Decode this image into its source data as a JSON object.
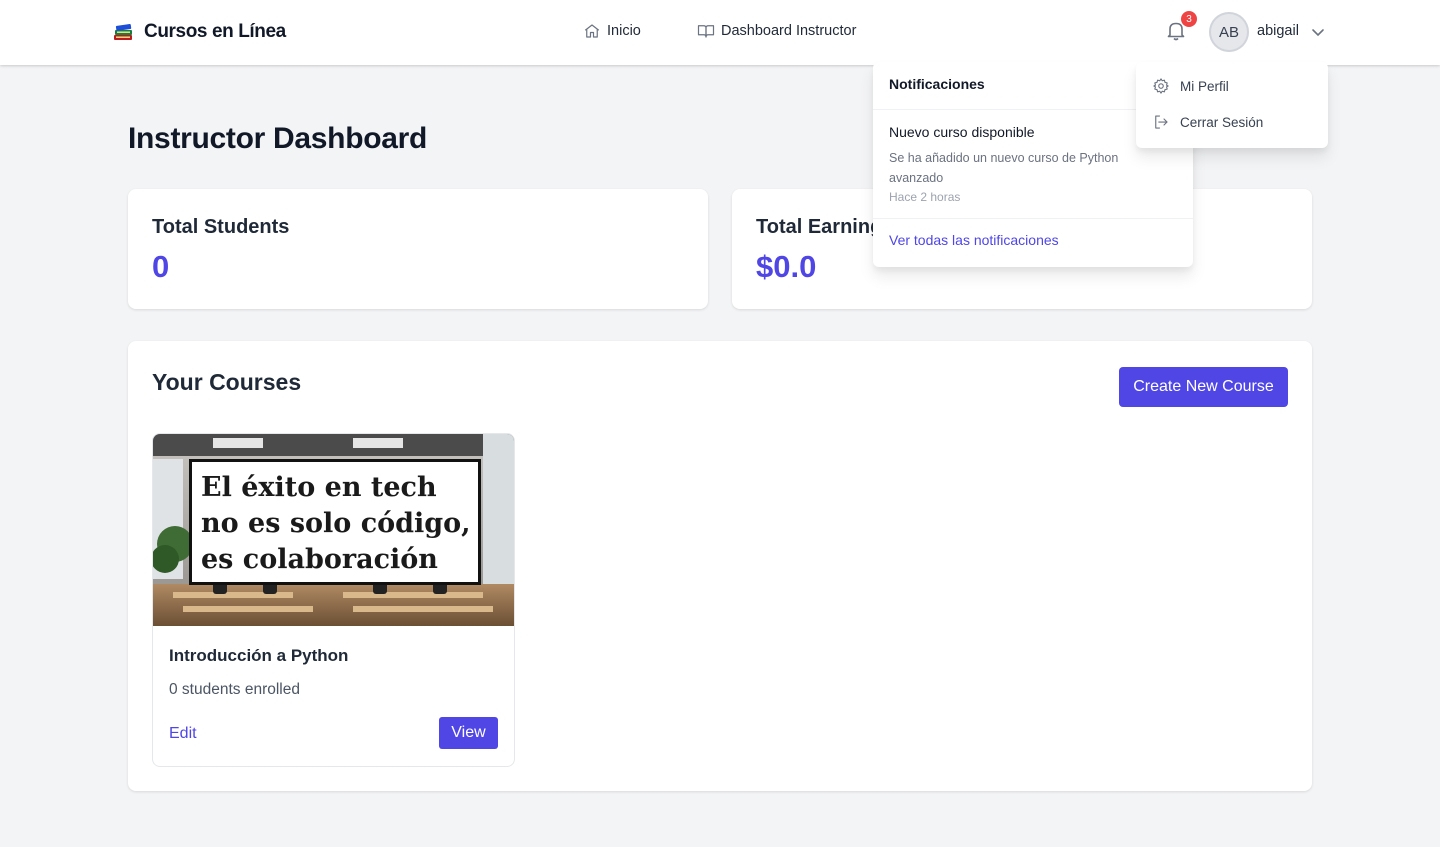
{
  "header": {
    "brand": "Cursos en Línea",
    "nav": [
      {
        "label": "Inicio",
        "icon": "home-icon"
      },
      {
        "label": "Dashboard Instructor",
        "icon": "book-open-icon"
      }
    ],
    "notification_count": "3",
    "avatar_initials": "AB",
    "username": "abigail"
  },
  "notifications": {
    "title": "Notificaciones",
    "items": [
      {
        "title": "Nuevo curso disponible",
        "body": "Se ha añadido un nuevo curso de Python avanzado",
        "time": "Hace 2 horas"
      }
    ],
    "view_all": "Ver todas las notificaciones"
  },
  "user_menu": {
    "items": [
      {
        "label": "Mi Perfil",
        "icon": "gear-icon"
      },
      {
        "label": "Cerrar Sesión",
        "icon": "logout-icon"
      }
    ]
  },
  "page": {
    "title": "Instructor Dashboard",
    "stats": [
      {
        "label": "Total Students",
        "value": "0"
      },
      {
        "label": "Total Earnings",
        "value": "$0.0"
      }
    ]
  },
  "courses": {
    "title": "Your Courses",
    "create_label": "Create New Course",
    "items": [
      {
        "image_caption": [
          "El éxito en  tech",
          "no es solo código,",
          "es colaboración"
        ],
        "name": "Introducción a Python",
        "meta": "0 students enrolled",
        "edit_label": "Edit",
        "view_label": "View"
      }
    ]
  },
  "colors": {
    "accent": "#4f46e5",
    "badge": "#ef4444",
    "background": "#f3f4f6"
  }
}
